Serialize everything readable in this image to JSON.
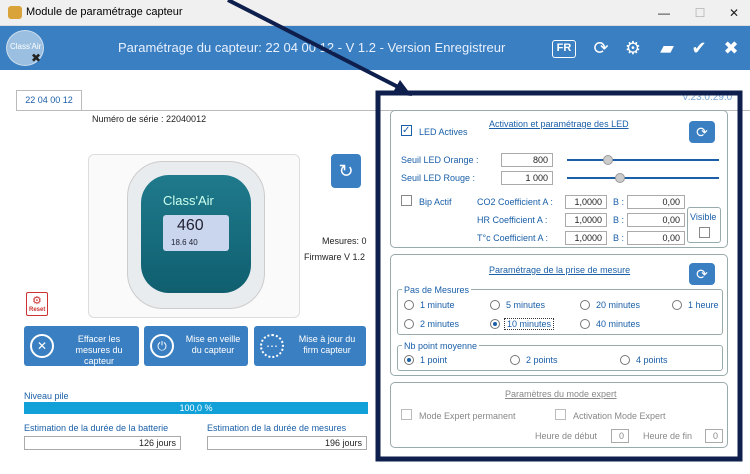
{
  "window": {
    "title": "Module de paramétrage capteur",
    "minimize": "—",
    "maximize": "☐",
    "close": "✕"
  },
  "header": {
    "title": "Paramétrage du capteur:  22 04 00 12 - V 1.2 - Version Enregistreur",
    "lang": "FR",
    "logo_text": "Class'Air",
    "accent": "#3a7fc1"
  },
  "tab": {
    "label": "22 04 00 12",
    "version": "V.23.0.29.0"
  },
  "device": {
    "serial_label": "Numéro de série : 22040012",
    "screen_value": "460",
    "screen_sub": "18.6  40",
    "brand": "Class'Air",
    "mesures_label": "Mesures: 0",
    "firmware_label": "Firmware V 1.2",
    "reset_label": "Reset"
  },
  "actions": [
    {
      "label": "Effacer les mesures du capteur",
      "icon": "erase-icon"
    },
    {
      "label": "Mise en veille du capteur",
      "icon": "power-icon"
    },
    {
      "label": "Mise à jour du firm capteur",
      "icon": "update-icon"
    }
  ],
  "battery": {
    "label": "Niveau pile",
    "value": "100,0 %",
    "fill": 1.0,
    "battery_duration_label": "Estimation de la durée de la batterie",
    "battery_duration_value": "126 jours",
    "measure_duration_label": "Estimation de la durée de mesures",
    "measure_duration_value": "196 jours"
  },
  "led": {
    "title": "Activation et paramétrage des LED",
    "active_label": "LED Actives",
    "orange_label": "Seuil LED Orange :",
    "orange_value": "800",
    "red_label": "Seuil LED Rouge :",
    "red_value": "1 000",
    "bip_label": "Bip Actif",
    "visible_label": "Visible",
    "coeffs": [
      {
        "label": "CO2 Coefficient A :",
        "a": "1,0000",
        "b_label": "B :",
        "b": "0,00"
      },
      {
        "label": "HR  Coefficient A :",
        "a": "1,0000",
        "b_label": "B :",
        "b": "0,00"
      },
      {
        "label": "T°c  Coefficient A :",
        "a": "1,0000",
        "b_label": "B :",
        "b": "0,00"
      }
    ]
  },
  "measure": {
    "title": "Paramétrage de la prise de mesure",
    "step_legend": "Pas de Mesures",
    "steps": [
      "1 minute",
      "5 minutes",
      "20 minutes",
      "1 heure",
      "2 minutes",
      "10 minutes",
      "40 minutes"
    ],
    "avg_legend": "Nb point moyenne",
    "avgs": [
      "1 point",
      "2 points",
      "4 points"
    ]
  },
  "expert": {
    "title": "Paramètres du mode expert",
    "permanent_label": "Mode Expert permanent",
    "activation_label": "Activation Mode Expert",
    "start_label": "Heure de début",
    "start_value": "0",
    "end_label": "Heure de fin",
    "end_value": "0"
  }
}
